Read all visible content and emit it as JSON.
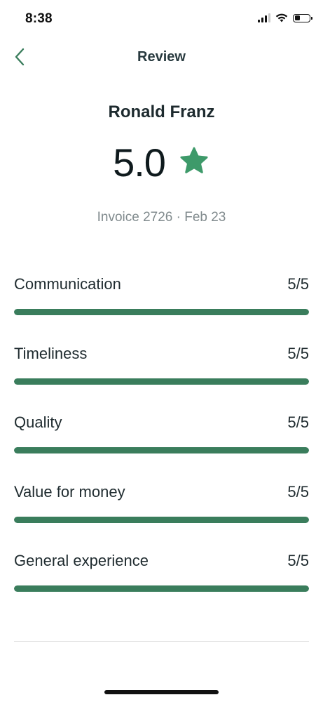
{
  "status_bar": {
    "time": "8:38",
    "battery_level": 0.35
  },
  "nav": {
    "back_icon": "chevron-left-icon",
    "title": "Review"
  },
  "review": {
    "reviewer_name": "Ronald Franz",
    "overall_score": "5.0",
    "star_icon": "star-icon",
    "invoice_line": "Invoice 2726 · Feb 23"
  },
  "categories": [
    {
      "label": "Communication",
      "score_text": "5/5",
      "score": 5,
      "max": 5
    },
    {
      "label": "Timeliness",
      "score_text": "5/5",
      "score": 5,
      "max": 5
    },
    {
      "label": "Quality",
      "score_text": "5/5",
      "score": 5,
      "max": 5
    },
    {
      "label": "Value for money",
      "score_text": "5/5",
      "score": 5,
      "max": 5
    },
    {
      "label": "General experience",
      "score_text": "5/5",
      "score": 5,
      "max": 5
    }
  ],
  "colors": {
    "accent": "#3a7d5c",
    "star": "#3e9a6a",
    "back_chevron": "#3a7d5c"
  }
}
